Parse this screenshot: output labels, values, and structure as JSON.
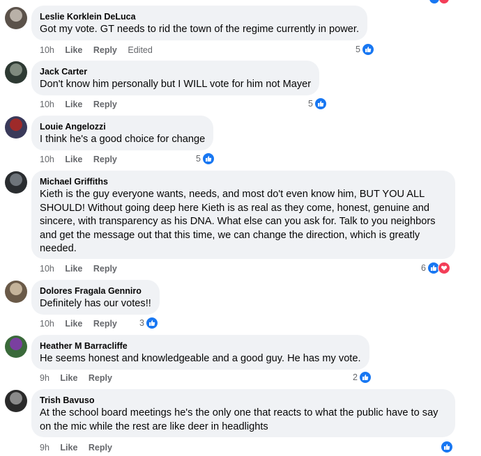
{
  "actions": {
    "like": "Like",
    "reply": "Reply",
    "edited": "Edited"
  },
  "comments": [
    {
      "author": "Leslie Korklein DeLuca",
      "text": "Got my vote. GT needs to rid the town of the regime currently in power.",
      "time": "10h",
      "edited": true,
      "reaction_count": "5",
      "avatar_colors": [
        "#b9b1a8",
        "#5b524a"
      ]
    },
    {
      "author": "Jack Carter",
      "text": "Don't know him personally but I WILL vote for him not Mayer",
      "time": "10h",
      "edited": false,
      "reaction_count": "5",
      "avatar_colors": [
        "#7f8a7e",
        "#2e3a33"
      ]
    },
    {
      "author": "Louie Angelozzi",
      "text": "I think he's a good choice for change",
      "time": "10h",
      "edited": false,
      "reaction_count": "5",
      "avatar_colors": [
        "#9e2a2a",
        "#3a3a5a"
      ]
    },
    {
      "author": "Michael Griffiths",
      "text": "Kieth is the guy everyone wants, needs, and most do't even know him, BUT YOU ALL SHOULD! Without going deep here Kieth is as real as they come, honest, genuine and sincere, with transparency as his DNA. What else can you ask for. Talk to you neighbors and get the message out that this time, we can change the direction, which is greatly needed.",
      "time": "10h",
      "edited": false,
      "reaction_count": "6",
      "reactions": [
        "like",
        "love"
      ],
      "avatar_colors": [
        "#6e747a",
        "#2a2d30"
      ]
    },
    {
      "author": "Dolores Fragala Genniro",
      "text": "Definitely has our votes!!",
      "time": "10h",
      "edited": false,
      "reaction_count": "3",
      "avatar_colors": [
        "#c4b39a",
        "#6a5a48"
      ]
    },
    {
      "author": "Heather M Barracliffe",
      "text": "He seems honest and knowledgeable and a good guy. He has my vote.",
      "time": "9h",
      "edited": false,
      "reaction_count": "2",
      "avatar_colors": [
        "#7a3fa0",
        "#3a6a3a"
      ]
    },
    {
      "author": "Trish Bavuso",
      "text": "At the school board meetings he's the only one that reacts to what the public have to say on the mic while the rest are like deer in headlights",
      "time": "9h",
      "edited": false,
      "reaction_count": "",
      "avatar_colors": [
        "#8a8a8a",
        "#2a2a2a"
      ]
    }
  ]
}
